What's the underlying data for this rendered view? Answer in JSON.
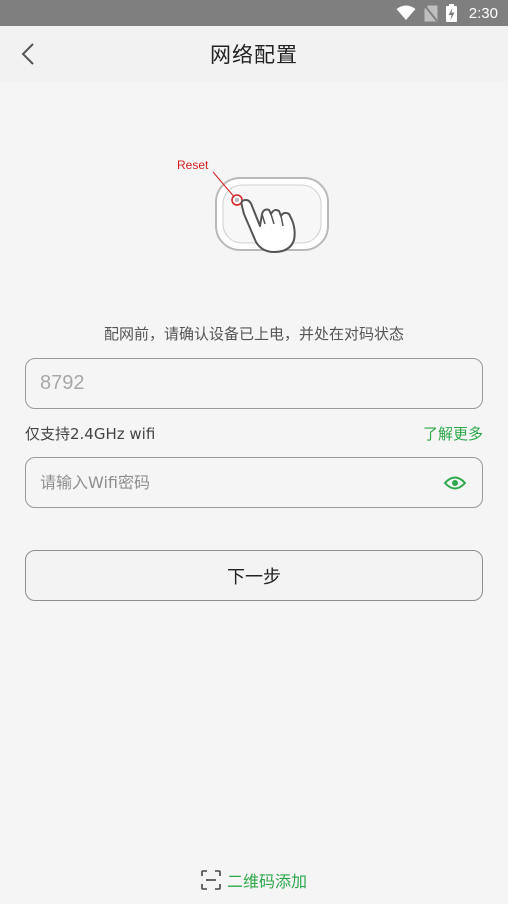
{
  "status_bar": {
    "time": "2:30",
    "icons": [
      "wifi-icon",
      "no-sim-icon",
      "battery-charging-icon"
    ]
  },
  "header": {
    "title": "网络配置",
    "back_icon": "chevron-left-icon"
  },
  "illustration": {
    "reset_label": "Reset",
    "accent_color": "#d42020"
  },
  "instruction": "配网前，请确认设备已上电，并处在对码状态",
  "ssid_field": {
    "value": "8792"
  },
  "support": {
    "text": "仅支持2.4GHz wifi",
    "learn_more": "了解更多"
  },
  "password_field": {
    "placeholder": "请输入Wifi密码",
    "value": "",
    "toggle_icon": "eye-icon"
  },
  "next_button": {
    "label": "下一步"
  },
  "qr_add": {
    "label": "二维码添加",
    "icon": "scan-icon"
  },
  "colors": {
    "accent_green": "#2ea84a",
    "status_bar": "#7f7f7f",
    "background": "#f5f5f5"
  }
}
